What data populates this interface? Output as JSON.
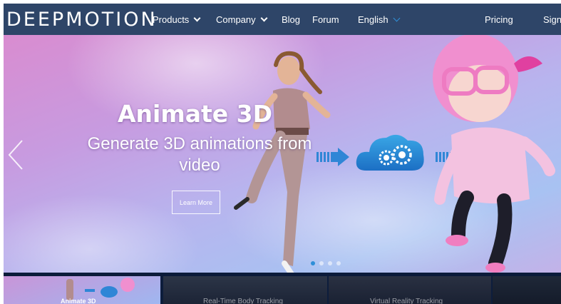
{
  "nav": {
    "logo": "DEEPMOTION",
    "items": [
      {
        "label": "Products",
        "has_dropdown": true
      },
      {
        "label": "Company",
        "has_dropdown": true
      },
      {
        "label": "Blog",
        "has_dropdown": false
      },
      {
        "label": "Forum",
        "has_dropdown": false
      },
      {
        "label": "English",
        "has_dropdown": true
      },
      {
        "label": "Pricing",
        "has_dropdown": false
      },
      {
        "label": "Sign",
        "has_dropdown": false
      }
    ]
  },
  "hero": {
    "title": "Animate 3D",
    "subtitle": "Generate 3D animations from video",
    "button_label": "Learn More",
    "slide_count": 4,
    "active_slide": 1
  },
  "thumbnails": [
    {
      "label": "Animate 3D"
    },
    {
      "label": "Real-Time Body Tracking"
    },
    {
      "label": "Virtual Reality Tracking"
    },
    {
      "label": ""
    }
  ],
  "colors": {
    "nav_bg": "#2e4568",
    "accent": "#2f8fd8",
    "thumb_bg": "#0d1d3c"
  }
}
